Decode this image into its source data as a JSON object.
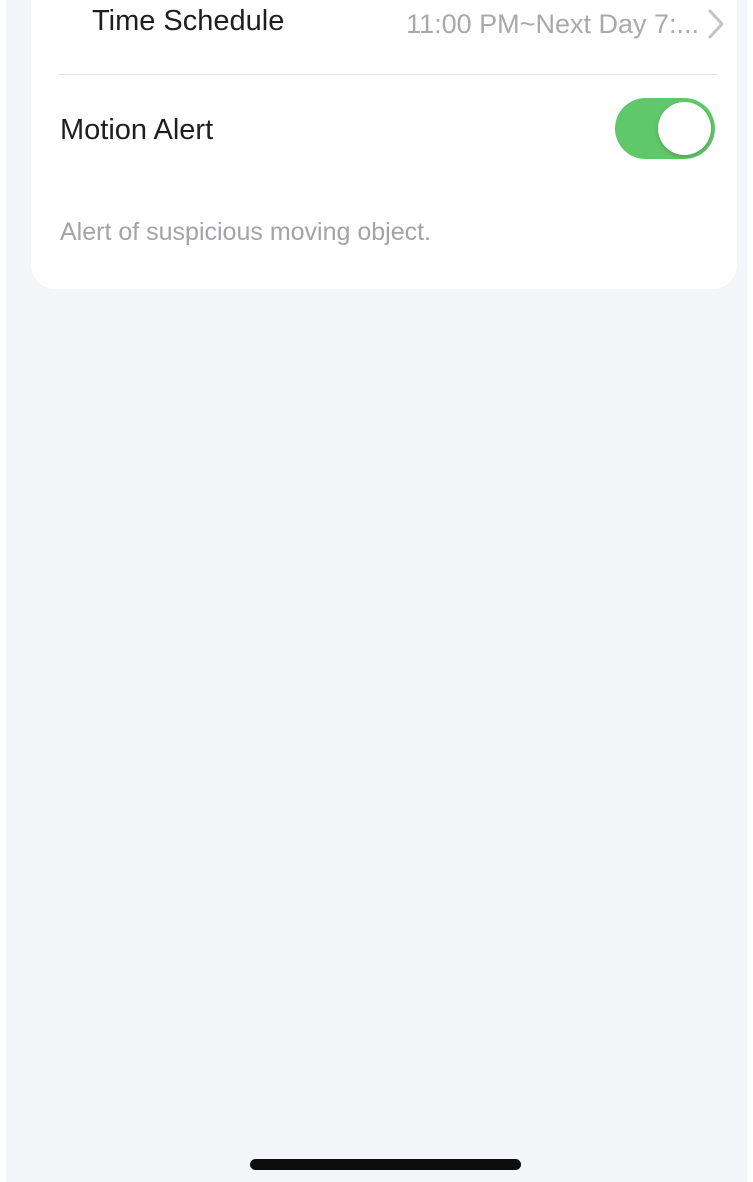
{
  "settings": {
    "time_schedule": {
      "label": "Time Schedule",
      "value": "11:00 PM~Next Day 7:...",
      "chevron_icon": "chevron-right-icon"
    },
    "motion_alert": {
      "label": "Motion Alert",
      "enabled": true,
      "description": "Alert of suspicious moving object."
    }
  },
  "colors": {
    "toggle_on": "#5fc868",
    "highlight": "#d9341c",
    "background": "#f4f5f9"
  }
}
